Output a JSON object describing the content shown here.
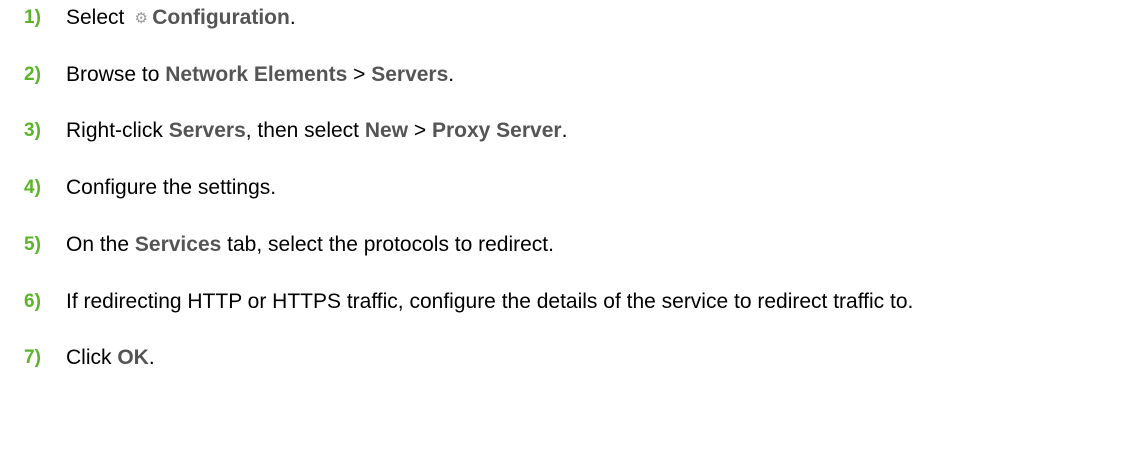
{
  "colors": {
    "step_number": "#5ab527",
    "ui_term": "#555555",
    "body_text": "#000000",
    "icon": "#9a9a9a"
  },
  "steps": [
    {
      "num": "1)",
      "parts": [
        "Select ",
        "Configuration",
        "."
      ],
      "icon": "gear-icon"
    },
    {
      "num": "2)",
      "parts": [
        "Browse to ",
        "Network Elements",
        " > ",
        "Servers",
        "."
      ]
    },
    {
      "num": "3)",
      "parts": [
        "Right-click ",
        "Servers",
        ", then select ",
        "New",
        " > ",
        "Proxy Server",
        "."
      ]
    },
    {
      "num": "4)",
      "parts": [
        "Configure the settings."
      ]
    },
    {
      "num": "5)",
      "parts": [
        "On the ",
        "Services",
        " tab, select the protocols to redirect."
      ]
    },
    {
      "num": "6)",
      "parts": [
        "If redirecting HTTP or HTTPS traffic, configure the details of the service to redirect traffic to."
      ]
    },
    {
      "num": "7)",
      "parts": [
        "Click ",
        "OK",
        "."
      ]
    }
  ]
}
